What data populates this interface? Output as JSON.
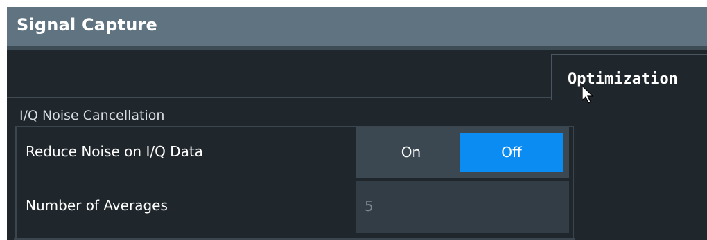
{
  "window": {
    "title": "Signal Capture"
  },
  "tabs": {
    "active_label": "Optimization"
  },
  "group": {
    "title": "I/Q Noise Cancellation",
    "reduce_noise": {
      "label": "Reduce Noise on I/Q Data",
      "options": [
        "On",
        "Off"
      ],
      "selected": "Off"
    },
    "averages": {
      "label": "Number of Averages",
      "value": "5"
    }
  },
  "colors": {
    "accent": "#0a8cf2",
    "titlebar": "#5f7381",
    "background": "#1f262c"
  }
}
